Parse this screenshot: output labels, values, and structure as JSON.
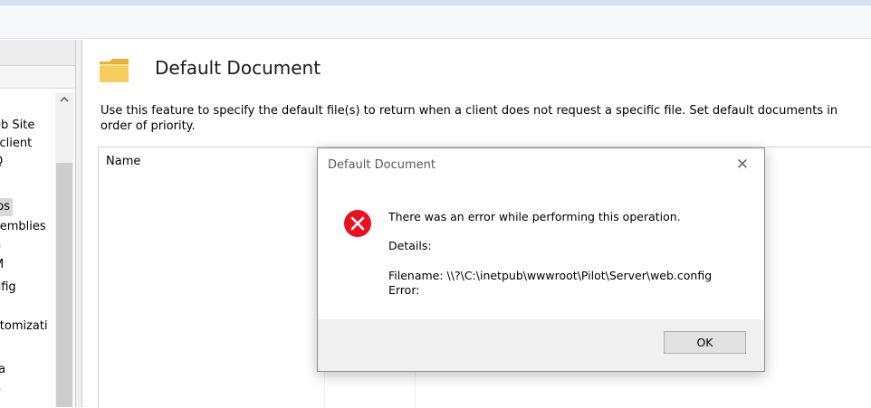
{
  "tree": {
    "items": [
      "eb Site",
      "_client",
      "Q",
      "",
      "ps",
      "semblies",
      "n",
      "M",
      "nfig",
      "F",
      "stomizati",
      "",
      "ta",
      "o"
    ]
  },
  "main": {
    "title": "Default Document",
    "description": "Use this feature to specify the default file(s) to return when a client does not request a specific file. Set default documents in order of priority.",
    "column_name": "Name"
  },
  "dialog": {
    "title": "Default Document",
    "close_glyph": "✕",
    "message": "There was an error while performing this operation.",
    "details_label": "Details:",
    "filename_line": "Filename: \\\\?\\C:\\inetpub\\wwwroot\\Pilot\\Server\\web.config",
    "error_line": "Error:",
    "ok_label": "OK"
  },
  "icons": {
    "folder": "folder-icon",
    "error": "error-icon",
    "scroll_up": "scroll-up-arrow"
  },
  "colors": {
    "error_red": "#e81123",
    "folder_yellow": "#f3c64b"
  }
}
